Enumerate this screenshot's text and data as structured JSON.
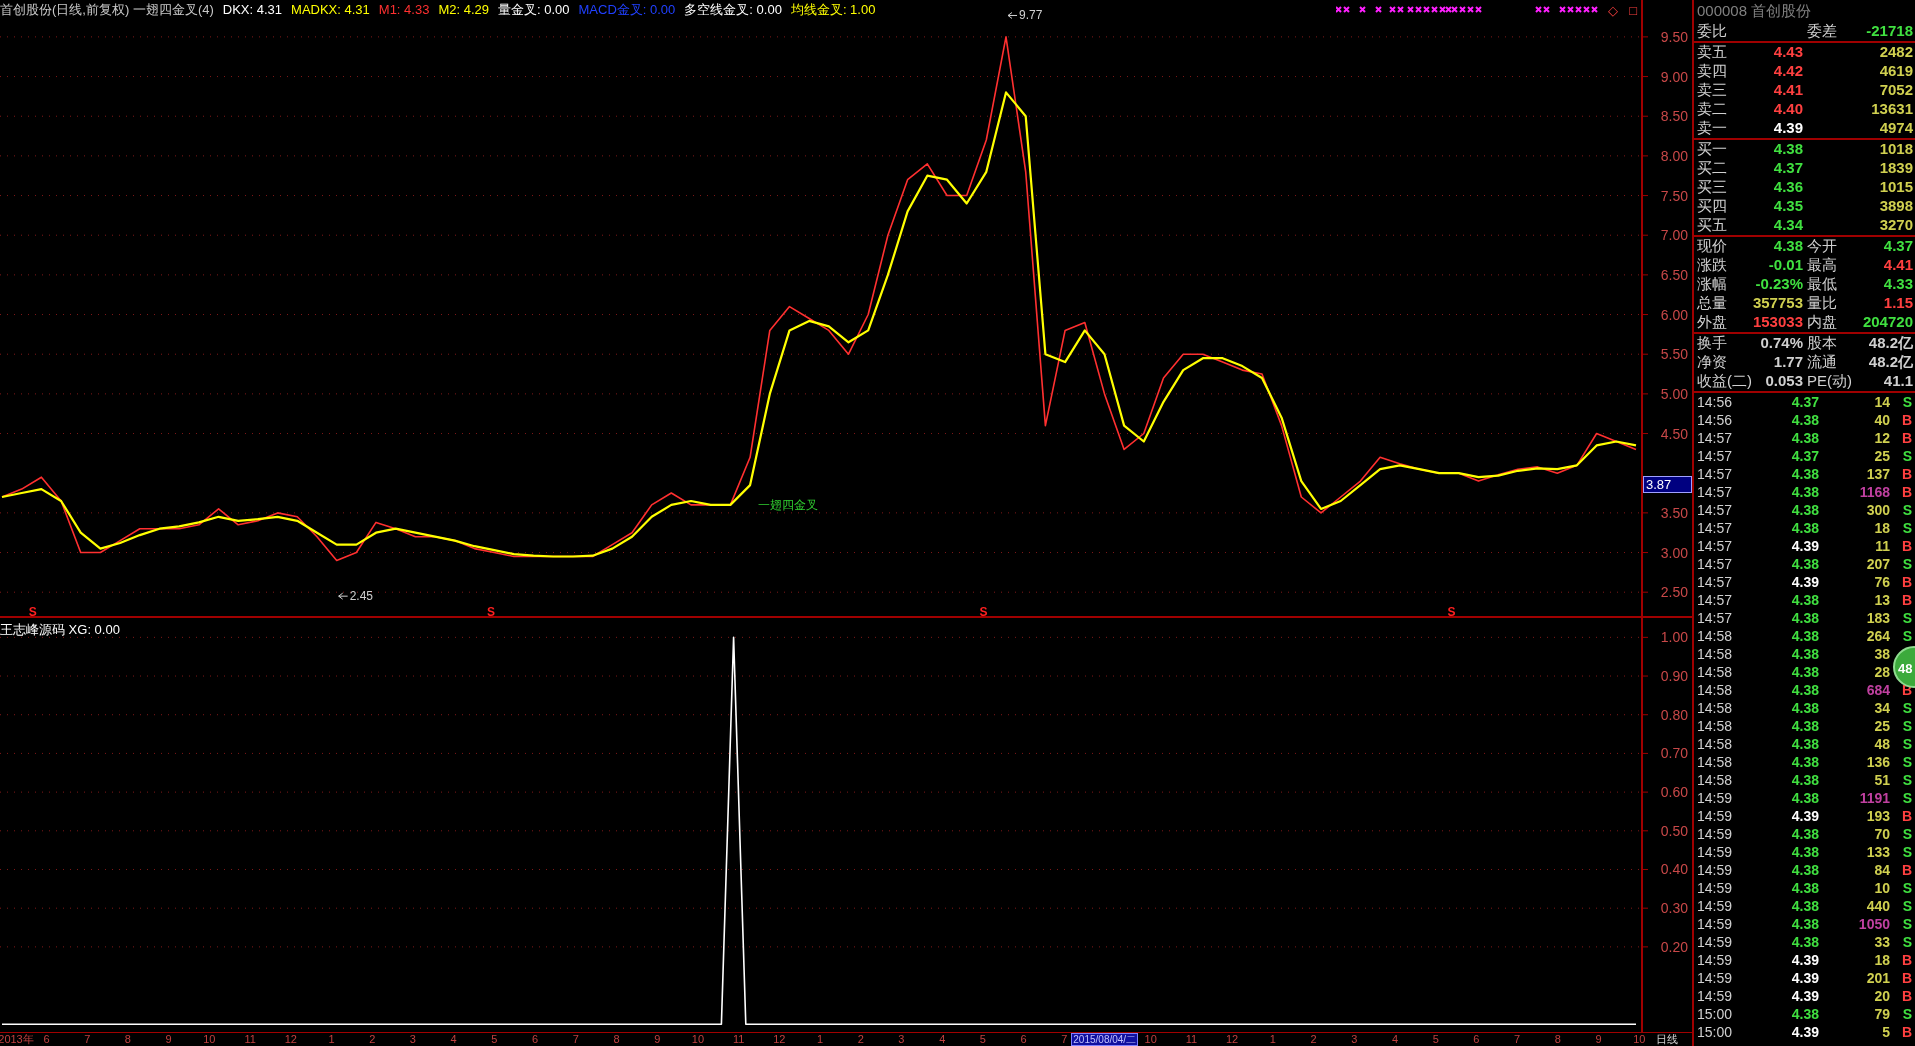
{
  "chart_header": {
    "items": [
      {
        "text": "首创股份(日线,前复权) 一翅四金叉(4)",
        "color": "#c8c8c8"
      },
      {
        "text": "DKX: 4.31",
        "color": "#ffffff"
      },
      {
        "text": "MADKX: 4.31",
        "color": "#ffff00"
      },
      {
        "text": "M1: 4.33",
        "color": "#ff3030"
      },
      {
        "text": "M2: 4.29",
        "color": "#ffff00"
      },
      {
        "text": "量金叉: 0.00",
        "color": "#ffffff"
      },
      {
        "text": "MACD金叉: 0.00",
        "color": "#2040ff"
      },
      {
        "text": "多空线金叉: 0.00",
        "color": "#ffffff"
      },
      {
        "text": "均线金叉: 1.00",
        "color": "#ffff00"
      }
    ],
    "icons": [
      "◇",
      "□"
    ]
  },
  "main_chart": {
    "cursor_label": "3.87",
    "markers": [
      {
        "kind": "peak",
        "text": "9.77"
      },
      {
        "kind": "low",
        "text": "2.45"
      },
      {
        "kind": "signal",
        "text": "一翅四金叉"
      },
      {
        "kind": "sell",
        "text": "S"
      },
      {
        "kind": "sell",
        "text": "S"
      },
      {
        "kind": "sell",
        "text": "S"
      },
      {
        "kind": "sell",
        "text": "S"
      }
    ],
    "chart_data": {
      "type": "line",
      "ylim": [
        2.2,
        9.965
      ],
      "grid": true,
      "categories": [
        null,
        null,
        null,
        null,
        null,
        null,
        null,
        null,
        null,
        null,
        null,
        null,
        null,
        null,
        null,
        null,
        null,
        null,
        null,
        null,
        null,
        null,
        null,
        null,
        null,
        null,
        null,
        null,
        null,
        null,
        null,
        null,
        null,
        null,
        null,
        null,
        null,
        null,
        null,
        null,
        null,
        null,
        null,
        null,
        null,
        null,
        null,
        null,
        null,
        null,
        null,
        null,
        null,
        null,
        null,
        null,
        null,
        null,
        null,
        null,
        null,
        null,
        null,
        null,
        null,
        null,
        null,
        null,
        null,
        null,
        null,
        null,
        null,
        null,
        null,
        null,
        null,
        null,
        null,
        null,
        null,
        null,
        null,
        null
      ],
      "yticks": [
        {
          "value": 2.5,
          "label": "2.50"
        },
        {
          "value": 3,
          "label": "3.00"
        },
        {
          "value": 3.5,
          "label": "3.50"
        },
        {
          "value": 4.5,
          "label": "4.50"
        },
        {
          "value": 5,
          "label": "5.00"
        },
        {
          "value": 5.5,
          "label": "5.50"
        },
        {
          "value": 6,
          "label": "6.00"
        },
        {
          "value": 6.5,
          "label": "6.50"
        },
        {
          "value": 7,
          "label": "7.00"
        },
        {
          "value": 7.5,
          "label": "7.50"
        },
        {
          "value": 8,
          "label": "8.00"
        },
        {
          "value": 8.5,
          "label": "8.50"
        },
        {
          "value": 9,
          "label": "9.00"
        },
        {
          "value": 9.5,
          "label": "9.50"
        }
      ],
      "series": [
        {
          "color": "#ff3030",
          "values": [
            3.7,
            3.8,
            3.95,
            3.65,
            3.0,
            3.0,
            3.15,
            3.3,
            3.3,
            3.3,
            3.35,
            3.55,
            3.35,
            3.4,
            3.5,
            3.45,
            3.2,
            2.9,
            3.0,
            3.38,
            3.3,
            3.2,
            3.2,
            3.15,
            3.05,
            3.0,
            2.95,
            2.95,
            2.95,
            2.95,
            2.95,
            3.1,
            3.25,
            3.6,
            3.75,
            3.6,
            3.6,
            3.6,
            4.2,
            5.8,
            6.1,
            5.95,
            5.8,
            5.5,
            6.0,
            7.0,
            7.7,
            7.9,
            7.5,
            7.5,
            8.2,
            9.5,
            7.8,
            4.6,
            5.8,
            5.9,
            5.0,
            4.3,
            4.5,
            5.2,
            5.5,
            5.5,
            5.4,
            5.3,
            5.25,
            4.6,
            3.7,
            3.5,
            3.7,
            3.9,
            4.2,
            4.12,
            4.05,
            4.0,
            4.0,
            3.9,
            3.98,
            4.05,
            4.08,
            4.0,
            4.1,
            4.5,
            4.4,
            4.3
          ]
        },
        {
          "color": "#ffff00",
          "values": [
            3.7,
            3.75,
            3.8,
            3.65,
            3.25,
            3.05,
            3.12,
            3.22,
            3.3,
            3.33,
            3.38,
            3.45,
            3.4,
            3.42,
            3.45,
            3.4,
            3.25,
            3.1,
            3.1,
            3.25,
            3.3,
            3.25,
            3.2,
            3.15,
            3.08,
            3.03,
            2.98,
            2.96,
            2.95,
            2.95,
            2.96,
            3.05,
            3.2,
            3.45,
            3.6,
            3.65,
            3.6,
            3.6,
            3.85,
            5.0,
            5.8,
            5.92,
            5.85,
            5.65,
            5.8,
            6.5,
            7.3,
            7.75,
            7.7,
            7.4,
            7.8,
            8.8,
            8.5,
            5.5,
            5.4,
            5.8,
            5.5,
            4.6,
            4.4,
            4.9,
            5.3,
            5.45,
            5.45,
            5.35,
            5.2,
            4.7,
            3.9,
            3.55,
            3.65,
            3.85,
            4.05,
            4.1,
            4.05,
            4.0,
            4.0,
            3.95,
            3.97,
            4.03,
            4.06,
            4.05,
            4.1,
            4.35,
            4.4,
            4.35
          ]
        }
      ]
    }
  },
  "lower_chart": {
    "title": "王志峰源码 XG: 0.00",
    "chart_data": {
      "type": "line",
      "ylim": [
        -0.02,
        1.05
      ],
      "grid": true,
      "categories": [
        null,
        null,
        null,
        null,
        null,
        null,
        null,
        null,
        null,
        null,
        null,
        null,
        null,
        null,
        null,
        null,
        null,
        null,
        null,
        null,
        null,
        null,
        null,
        null,
        null,
        null,
        null,
        null,
        null,
        null,
        null,
        null,
        null,
        null,
        null,
        null,
        null,
        null,
        null,
        null,
        null,
        null,
        null,
        null,
        null,
        null,
        null,
        null,
        null,
        null,
        null,
        null,
        null,
        null,
        null,
        null,
        null,
        null,
        null,
        null,
        null,
        null,
        null,
        null,
        null,
        null,
        null,
        null,
        null,
        null,
        null,
        null,
        null,
        null,
        null,
        null,
        null,
        null,
        null,
        null,
        null,
        null,
        null,
        null,
        null,
        null,
        null,
        null,
        null,
        null,
        null,
        null,
        null,
        null,
        null,
        null,
        null,
        null,
        null,
        null,
        null,
        null,
        null,
        null,
        null,
        null,
        null,
        null,
        null,
        null,
        null,
        null,
        null,
        null,
        null,
        null,
        null,
        null,
        null,
        null,
        null,
        null,
        null,
        null,
        null,
        null,
        null,
        null,
        null,
        null,
        null,
        null,
        null,
        null,
        null
      ],
      "yticks": [
        {
          "value": 0.2,
          "label": "0.20"
        },
        {
          "value": 0.3,
          "label": "0.30"
        },
        {
          "value": 0.4,
          "label": "0.40"
        },
        {
          "value": 0.5,
          "label": "0.50"
        },
        {
          "value": 0.6,
          "label": "0.60"
        },
        {
          "value": 0.7,
          "label": "0.70"
        },
        {
          "value": 0.8,
          "label": "0.80"
        },
        {
          "value": 0.9,
          "label": "0.90"
        },
        {
          "value": 1.0,
          "label": "1.00"
        }
      ],
      "series": [
        {
          "color": "#ffffff",
          "values": [
            0,
            0,
            0,
            0,
            0,
            0,
            0,
            0,
            0,
            0,
            0,
            0,
            0,
            0,
            0,
            0,
            0,
            0,
            0,
            0,
            0,
            0,
            0,
            0,
            0,
            0,
            0,
            0,
            0,
            0,
            0,
            0,
            0,
            0,
            0,
            0,
            0,
            0,
            0,
            0,
            0,
            0,
            0,
            0,
            0,
            0,
            0,
            0,
            0,
            0,
            0,
            0,
            0,
            0,
            0,
            0,
            0,
            0,
            0,
            0,
            1,
            0,
            0,
            0,
            0,
            0,
            0,
            0,
            0,
            0,
            0,
            0,
            0,
            0,
            0,
            0,
            0,
            0,
            0,
            0,
            0,
            0,
            0,
            0,
            0,
            0,
            0,
            0,
            0,
            0,
            0,
            0,
            0,
            0,
            0,
            0,
            0,
            0,
            0,
            0,
            0,
            0,
            0,
            0,
            0,
            0,
            0,
            0,
            0,
            0,
            0,
            0,
            0,
            0,
            0,
            0,
            0,
            0,
            0,
            0,
            0,
            0,
            0,
            0,
            0,
            0,
            0,
            0,
            0,
            0,
            0,
            0,
            0,
            0,
            0
          ]
        }
      ]
    }
  },
  "time_axis": {
    "labels": [
      {
        "text": "2013年",
        "selected": false
      },
      {
        "text": "6",
        "selected": false
      },
      {
        "text": "7",
        "selected": false
      },
      {
        "text": "8",
        "selected": false
      },
      {
        "text": "9",
        "selected": false
      },
      {
        "text": "10",
        "selected": false
      },
      {
        "text": "11",
        "selected": false
      },
      {
        "text": "12",
        "selected": false
      },
      {
        "text": "1",
        "selected": false
      },
      {
        "text": "2",
        "selected": false
      },
      {
        "text": "3",
        "selected": false
      },
      {
        "text": "4",
        "selected": false
      },
      {
        "text": "5",
        "selected": false
      },
      {
        "text": "6",
        "selected": false
      },
      {
        "text": "7",
        "selected": false
      },
      {
        "text": "8",
        "selected": false
      },
      {
        "text": "9",
        "selected": false
      },
      {
        "text": "10",
        "selected": false
      },
      {
        "text": "11",
        "selected": false
      },
      {
        "text": "12",
        "selected": false
      },
      {
        "text": "1",
        "selected": false
      },
      {
        "text": "2",
        "selected": false
      },
      {
        "text": "3",
        "selected": false
      },
      {
        "text": "4",
        "selected": false
      },
      {
        "text": "5",
        "selected": false
      },
      {
        "text": "6",
        "selected": false
      },
      {
        "text": "7",
        "selected": false
      },
      {
        "text": "2015/08/04/二",
        "selected": true
      },
      {
        "text": "10",
        "selected": false
      },
      {
        "text": "11",
        "selected": false
      },
      {
        "text": "12",
        "selected": false
      },
      {
        "text": "1",
        "selected": false
      },
      {
        "text": "2",
        "selected": false
      },
      {
        "text": "3",
        "selected": false
      },
      {
        "text": "4",
        "selected": false
      },
      {
        "text": "5",
        "selected": false
      },
      {
        "text": "6",
        "selected": false
      },
      {
        "text": "7",
        "selected": false
      },
      {
        "text": "8",
        "selected": false
      },
      {
        "text": "9",
        "selected": false
      },
      {
        "text": "10",
        "selected": false
      }
    ],
    "period": "日线"
  },
  "quote_panel": {
    "title": "000008 首创股份",
    "ratio_row": {
      "cells": [
        {
          "label": "委比"
        },
        {
          "label": "委差",
          "value": "-21718",
          "color": "#40e040"
        }
      ]
    },
    "asks": [
      {
        "label": "卖五",
        "price": "4.43",
        "color": "#ff4040",
        "volume": "2482"
      },
      {
        "label": "卖四",
        "price": "4.42",
        "color": "#ff4040",
        "volume": "4619"
      },
      {
        "label": "卖三",
        "price": "4.41",
        "color": "#ff4040",
        "volume": "7052"
      },
      {
        "label": "卖二",
        "price": "4.40",
        "color": "#ff4040",
        "volume": "13631"
      },
      {
        "label": "卖一",
        "price": "4.39",
        "color": "#ffffff",
        "volume": "4974"
      }
    ],
    "bids": [
      {
        "label": "买一",
        "price": "4.38",
        "color": "#40e040",
        "volume": "1018"
      },
      {
        "label": "买二",
        "price": "4.37",
        "color": "#40e040",
        "volume": "1839"
      },
      {
        "label": "买三",
        "price": "4.36",
        "color": "#40e040",
        "volume": "1015"
      },
      {
        "label": "买四",
        "price": "4.35",
        "color": "#40e040",
        "volume": "3898"
      },
      {
        "label": "买五",
        "price": "4.34",
        "color": "#40e040",
        "volume": "3270"
      }
    ],
    "stats": [
      {
        "cells": [
          {
            "label": "现价",
            "value": "4.38",
            "color": "#40e040"
          },
          {
            "label": "今开",
            "value": "4.37",
            "color": "#40e040"
          }
        ]
      },
      {
        "cells": [
          {
            "label": "涨跌",
            "value": "-0.01",
            "color": "#40e040"
          },
          {
            "label": "最高",
            "value": "4.41",
            "color": "#ff4040"
          }
        ]
      },
      {
        "cells": [
          {
            "label": "涨幅",
            "value": "-0.23%",
            "color": "#40e040"
          },
          {
            "label": "最低",
            "value": "4.33",
            "color": "#40e040"
          }
        ]
      },
      {
        "cells": [
          {
            "label": "总量",
            "value": "357753",
            "color": "#d0d050"
          },
          {
            "label": "量比",
            "value": "1.15",
            "color": "#ff4040"
          }
        ]
      },
      {
        "cells": [
          {
            "label": "外盘",
            "value": "153033",
            "color": "#ff4040"
          },
          {
            "label": "内盘",
            "value": "204720",
            "color": "#40e040"
          }
        ]
      }
    ],
    "fundamentals": [
      {
        "cells": [
          {
            "label": "换手",
            "value": "0.74%",
            "color": "#d0d0d0"
          },
          {
            "label": "股本",
            "value": "48.2亿",
            "color": "#d0d0d0"
          }
        ]
      },
      {
        "cells": [
          {
            "label": "净资",
            "value": "1.77",
            "color": "#d0d0d0"
          },
          {
            "label": "流通",
            "value": "48.2亿",
            "color": "#d0d0d0"
          }
        ]
      },
      {
        "cells": [
          {
            "label": "收益(二)",
            "value": "0.053",
            "color": "#d0d0d0"
          },
          {
            "label": "PE(动)",
            "value": "41.1",
            "color": "#d0d0d0"
          }
        ]
      }
    ],
    "ticks": [
      {
        "time": "14:56",
        "price": "4.37",
        "color": "#40e040",
        "volume": "14",
        "big": false,
        "side": "S",
        "buy": false
      },
      {
        "time": "14:56",
        "price": "4.38",
        "color": "#40e040",
        "volume": "40",
        "big": false,
        "side": "B",
        "buy": true
      },
      {
        "time": "14:57",
        "price": "4.38",
        "color": "#40e040",
        "volume": "12",
        "big": false,
        "side": "B",
        "buy": true
      },
      {
        "time": "14:57",
        "price": "4.37",
        "color": "#40e040",
        "volume": "25",
        "big": false,
        "side": "S",
        "buy": false
      },
      {
        "time": "14:57",
        "price": "4.38",
        "color": "#40e040",
        "volume": "137",
        "big": false,
        "side": "B",
        "buy": true
      },
      {
        "time": "14:57",
        "price": "4.38",
        "color": "#40e040",
        "volume": "1168",
        "big": true,
        "side": "B",
        "buy": true
      },
      {
        "time": "14:57",
        "price": "4.38",
        "color": "#40e040",
        "volume": "300",
        "big": false,
        "side": "S",
        "buy": false
      },
      {
        "time": "14:57",
        "price": "4.38",
        "color": "#40e040",
        "volume": "18",
        "big": false,
        "side": "S",
        "buy": false
      },
      {
        "time": "14:57",
        "price": "4.39",
        "color": "#ffffff",
        "volume": "11",
        "big": false,
        "side": "B",
        "buy": true
      },
      {
        "time": "14:57",
        "price": "4.38",
        "color": "#40e040",
        "volume": "207",
        "big": false,
        "side": "S",
        "buy": false
      },
      {
        "time": "14:57",
        "price": "4.39",
        "color": "#ffffff",
        "volume": "76",
        "big": false,
        "side": "B",
        "buy": true
      },
      {
        "time": "14:57",
        "price": "4.38",
        "color": "#40e040",
        "volume": "13",
        "big": false,
        "side": "B",
        "buy": true
      },
      {
        "time": "14:57",
        "price": "4.38",
        "color": "#40e040",
        "volume": "183",
        "big": false,
        "side": "S",
        "buy": false
      },
      {
        "time": "14:58",
        "price": "4.38",
        "color": "#40e040",
        "volume": "264",
        "big": false,
        "side": "S",
        "buy": false
      },
      {
        "time": "14:58",
        "price": "4.38",
        "color": "#40e040",
        "volume": "38",
        "big": false
      },
      {
        "time": "14:58",
        "price": "4.38",
        "color": "#40e040",
        "volume": "28",
        "big": false
      },
      {
        "time": "14:58",
        "price": "4.38",
        "color": "#40e040",
        "volume": "684",
        "big": true,
        "side": "B",
        "buy": true
      },
      {
        "time": "14:58",
        "price": "4.38",
        "color": "#40e040",
        "volume": "34",
        "big": false,
        "side": "S",
        "buy": false
      },
      {
        "time": "14:58",
        "price": "4.38",
        "color": "#40e040",
        "volume": "25",
        "big": false,
        "side": "S",
        "buy": false
      },
      {
        "time": "14:58",
        "price": "4.38",
        "color": "#40e040",
        "volume": "48",
        "big": false,
        "side": "S",
        "buy": false
      },
      {
        "time": "14:58",
        "price": "4.38",
        "color": "#40e040",
        "volume": "136",
        "big": false,
        "side": "S",
        "buy": false
      },
      {
        "time": "14:58",
        "price": "4.38",
        "color": "#40e040",
        "volume": "51",
        "big": false,
        "side": "S",
        "buy": false
      },
      {
        "time": "14:59",
        "price": "4.38",
        "color": "#40e040",
        "volume": "1191",
        "big": true,
        "side": "S",
        "buy": false
      },
      {
        "time": "14:59",
        "price": "4.39",
        "color": "#ffffff",
        "volume": "193",
        "big": false,
        "side": "B",
        "buy": true
      },
      {
        "time": "14:59",
        "price": "4.38",
        "color": "#40e040",
        "volume": "70",
        "big": false,
        "side": "S",
        "buy": false
      },
      {
        "time": "14:59",
        "price": "4.38",
        "color": "#40e040",
        "volume": "133",
        "big": false,
        "side": "S",
        "buy": false
      },
      {
        "time": "14:59",
        "price": "4.38",
        "color": "#40e040",
        "volume": "84",
        "big": false,
        "side": "B",
        "buy": true
      },
      {
        "time": "14:59",
        "price": "4.38",
        "color": "#40e040",
        "volume": "10",
        "big": false,
        "side": "S",
        "buy": false
      },
      {
        "time": "14:59",
        "price": "4.38",
        "color": "#40e040",
        "volume": "440",
        "big": false,
        "side": "S",
        "buy": false
      },
      {
        "time": "14:59",
        "price": "4.38",
        "color": "#40e040",
        "volume": "1050",
        "big": true,
        "side": "S",
        "buy": false
      },
      {
        "time": "14:59",
        "price": "4.38",
        "color": "#40e040",
        "volume": "33",
        "big": false,
        "side": "S",
        "buy": false
      },
      {
        "time": "14:59",
        "price": "4.39",
        "color": "#ffffff",
        "volume": "18",
        "big": false,
        "side": "B",
        "buy": true
      },
      {
        "time": "14:59",
        "price": "4.39",
        "color": "#ffffff",
        "volume": "201",
        "big": false,
        "side": "B",
        "buy": true
      },
      {
        "time": "14:59",
        "price": "4.39",
        "color": "#ffffff",
        "volume": "20",
        "big": false,
        "side": "B",
        "buy": true
      },
      {
        "time": "15:00",
        "price": "4.38",
        "color": "#40e040",
        "volume": "79",
        "big": false,
        "side": "S",
        "buy": false
      },
      {
        "time": "15:00",
        "price": "4.39",
        "color": "#ffffff",
        "volume": "5",
        "big": false,
        "side": "B",
        "buy": true
      }
    ]
  },
  "float_badge": "48"
}
